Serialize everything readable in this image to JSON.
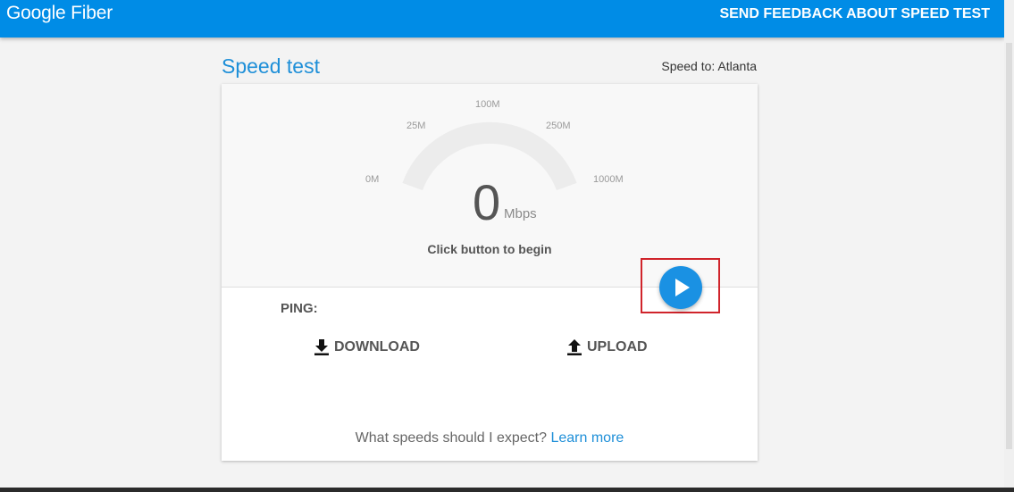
{
  "header": {
    "brand": "Google Fiber",
    "feedback_label": "SEND FEEDBACK ABOUT SPEED TEST"
  },
  "main": {
    "title": "Speed test",
    "speed_to": "Speed to: Atlanta"
  },
  "gauge": {
    "ticks": [
      "0M",
      "25M",
      "100M",
      "250M",
      "1000M"
    ],
    "value": "0",
    "unit": "Mbps",
    "status": "Click button to begin"
  },
  "results": {
    "ping_label": "PING:",
    "download_label": "DOWNLOAD",
    "upload_label": "UPLOAD"
  },
  "footer": {
    "question": "What speeds should I expect?",
    "learn_more": "Learn more"
  },
  "icons": {
    "play": "play-icon",
    "download": "download-icon",
    "upload": "upload-icon"
  },
  "colors": {
    "brand_blue": "#008ce6",
    "accent_blue": "#1e8fd8",
    "highlight_red": "#d0242b"
  }
}
